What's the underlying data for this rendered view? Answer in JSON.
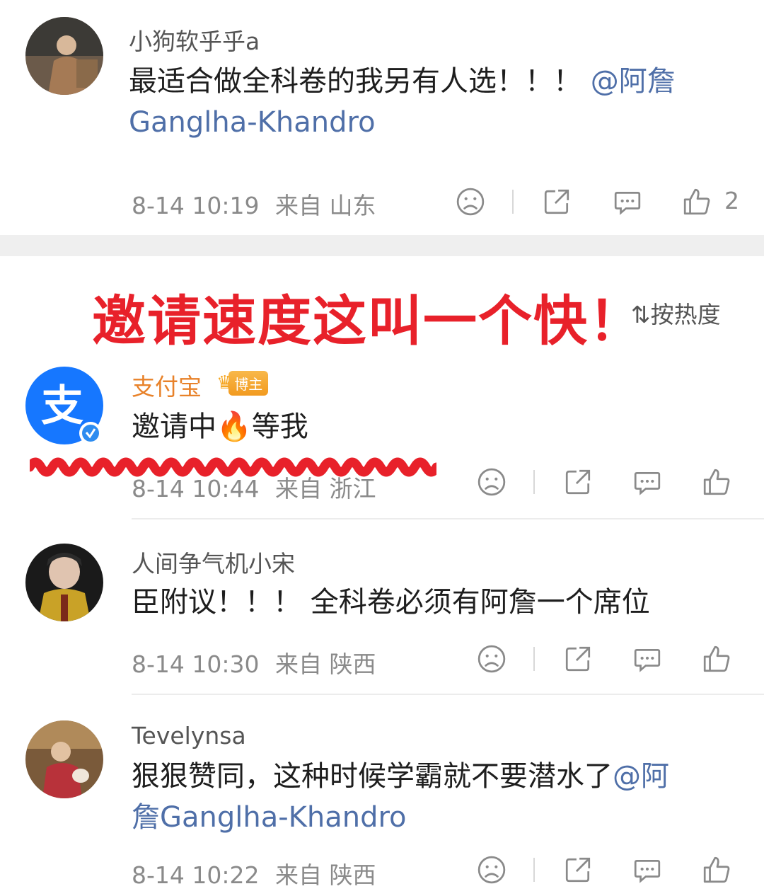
{
  "comments": [
    {
      "username": "小狗软乎乎a",
      "text": "最适合做全科卷的我另有人选！！！",
      "mention_line1": "@阿詹",
      "mention_line2": "Ganglha-Khandro",
      "timestamp": "8-14 10:19",
      "location": "来自 山东",
      "likes": "2"
    },
    {
      "username": "支付宝",
      "badge": "博主",
      "text_before": "邀请中",
      "emoji": "🔥",
      "text_after": "等我",
      "timestamp": "8-14 10:44",
      "location": "来自 浙江",
      "avatar_glyph": "支"
    },
    {
      "username": "人间争气机小宋",
      "text": "臣附议！！！ 全科卷必须有阿詹一个席位",
      "timestamp": "8-14 10:30",
      "location": "来自 陕西"
    },
    {
      "username": "Tevelynsa",
      "text": "狠狠赞同，这种时候学霸就不要潜水了",
      "mention_line1": "@阿",
      "mention_line2": "詹Ganglha-Khandro",
      "timestamp": "8-14 10:22",
      "location": "来自 陕西"
    }
  ],
  "headline": "邀请速度这叫一个快！",
  "sort_label": "按热度",
  "sort_icon": "⇅",
  "colors": {
    "mention": "#4f6fa8",
    "headline": "#e8212a",
    "alipay": "#1677ff",
    "username_highlight": "#e8822a"
  }
}
